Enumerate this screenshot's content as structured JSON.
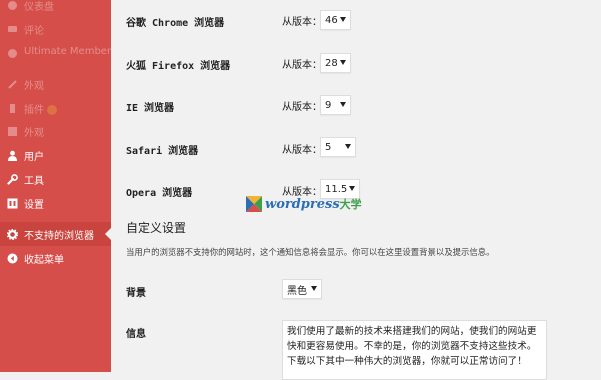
{
  "sidebar": {
    "items": [
      {
        "label": "仪表盘",
        "icon": "dashboard-icon"
      },
      {
        "label": "评论",
        "icon": "comments-icon"
      },
      {
        "label": "Ultimate Member",
        "icon": "ultimate-member-icon"
      },
      {
        "label": "外观",
        "icon": "appearance-brush-icon"
      },
      {
        "label": "插件",
        "icon": "plugin-icon"
      },
      {
        "label": "外观",
        "icon": "appearance-icon"
      },
      {
        "label": "用户",
        "icon": "user-icon"
      },
      {
        "label": "工具",
        "icon": "wrench-icon"
      },
      {
        "label": "设置",
        "icon": "settings-icon"
      },
      {
        "label": "不支持的浏览器",
        "icon": "gear-icon"
      },
      {
        "label": "收起菜单",
        "icon": "collapse-icon"
      }
    ]
  },
  "browsers": {
    "from_label": "从版本：",
    "rows": [
      {
        "label": "谷歌 Chrome 浏览器",
        "version": "46"
      },
      {
        "label": "火狐 Firefox 浏览器",
        "version": "28"
      },
      {
        "label": "IE 浏览器",
        "version": "9"
      },
      {
        "label": "Safari 浏览器",
        "version": "5"
      },
      {
        "label": "Opera 浏览器",
        "version": "11.5"
      }
    ]
  },
  "custom_settings": {
    "title": "自定义设置",
    "description": "当用户的浏览器不支持你的网站时，这个通知信息将会显示。你可以在这里设置背景以及提示信息。",
    "background_label": "背景",
    "background_value": "黑色",
    "message_label": "信息",
    "message_value": "我们使用了最新的技术来搭建我们的网站，使我们的网站更快和更容易使用。不幸的是，你的浏览器不支持这些技术。下载以下其中一种伟大的浏览器，你就可以正常访问了！"
  },
  "watermark": {
    "text": "wordpress",
    "suffix": "大学"
  },
  "colors": {
    "sidebar": "#d54e4a",
    "background": "#f1f1f1"
  }
}
